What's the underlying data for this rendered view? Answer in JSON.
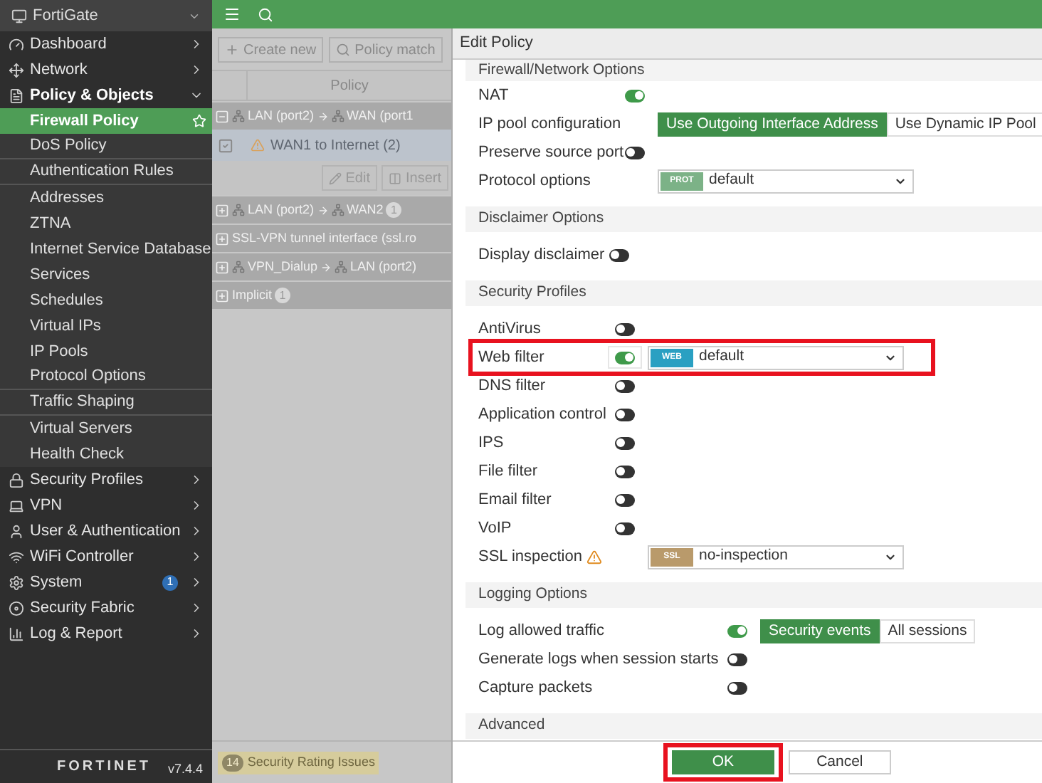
{
  "sidebar": {
    "device": "FortiGate",
    "items": [
      {
        "label": "Dashboard",
        "expanded": false
      },
      {
        "label": "Network",
        "expanded": false
      },
      {
        "label": "Policy & Objects",
        "expanded": true,
        "children": [
          {
            "label": "Firewall Policy",
            "selected": true,
            "group_end": false
          },
          {
            "label": "DoS Policy",
            "selected": false,
            "group_end": true
          },
          {
            "label": "Authentication Rules",
            "selected": false,
            "group_end": true
          },
          {
            "label": "Addresses",
            "selected": false,
            "group_end": false
          },
          {
            "label": "ZTNA",
            "selected": false,
            "group_end": false
          },
          {
            "label": "Internet Service Database",
            "selected": false,
            "group_end": false
          },
          {
            "label": "Services",
            "selected": false,
            "group_end": false
          },
          {
            "label": "Schedules",
            "selected": false,
            "group_end": false
          },
          {
            "label": "Virtual IPs",
            "selected": false,
            "group_end": false
          },
          {
            "label": "IP Pools",
            "selected": false,
            "group_end": false
          },
          {
            "label": "Protocol Options",
            "selected": false,
            "group_end": true
          },
          {
            "label": "Traffic Shaping",
            "selected": false,
            "group_end": true
          },
          {
            "label": "Virtual Servers",
            "selected": false,
            "group_end": false
          },
          {
            "label": "Health Check",
            "selected": false,
            "group_end": false
          }
        ]
      },
      {
        "label": "Security Profiles",
        "expanded": false
      },
      {
        "label": "VPN",
        "expanded": false
      },
      {
        "label": "User & Authentication",
        "expanded": false
      },
      {
        "label": "WiFi Controller",
        "expanded": false
      },
      {
        "label": "System",
        "expanded": false,
        "badge": "1"
      },
      {
        "label": "Security Fabric",
        "expanded": false
      },
      {
        "label": "Log & Report",
        "expanded": false
      }
    ],
    "brand": "FORTINET",
    "version": "v7.4.4"
  },
  "toolbar": [
    "Create new",
    "Policy match"
  ],
  "table": {
    "columns": [
      "Policy"
    ],
    "rows": [
      {
        "kind": "group",
        "expanded": true,
        "from": "LAN (port2)",
        "to": "WAN (port1"
      },
      {
        "kind": "policy",
        "checked": true,
        "name": "WAN1 to Internet (2)"
      },
      {
        "kind": "actions",
        "buttons": [
          "Edit",
          "Insert"
        ]
      },
      {
        "kind": "group",
        "expanded": false,
        "from": "LAN (port2)",
        "to": "WAN2",
        "count": "1"
      },
      {
        "kind": "group",
        "expanded": false,
        "from": "SSL-VPN tunnel interface (ssl.ro"
      },
      {
        "kind": "group",
        "expanded": false,
        "from": "VPN_Dialup",
        "to": "LAN (port2)"
      },
      {
        "kind": "group",
        "expanded": false,
        "from": "Implicit",
        "count": "1"
      }
    ]
  },
  "status_bar": {
    "count": "14",
    "label": "Security Rating Issues"
  },
  "dialog": {
    "title": "Edit Policy",
    "sections": [
      {
        "title": "Firewall/Network Options",
        "rows": [
          {
            "label": "NAT",
            "on": true
          },
          {
            "label": "IP pool configuration",
            "options": [
              {
                "label": "Use Outgoing Interface Address",
                "selected": true
              },
              {
                "label": "Use Dynamic IP Pool",
                "selected": false
              }
            ]
          },
          {
            "label": "Preserve source port",
            "on": false
          },
          {
            "label": "Protocol options",
            "select": {
              "tag": "PROT",
              "color": "#7cb287",
              "value": "default"
            }
          }
        ]
      },
      {
        "title": "Disclaimer Options",
        "rows": [
          {
            "label": "Display disclaimer",
            "on": false
          }
        ]
      },
      {
        "title": "Security Profiles",
        "rows": [
          {
            "label": "AntiVirus",
            "on": false
          },
          {
            "label": "Web filter",
            "on": true,
            "highlighted": true,
            "select": {
              "tag": "WEB",
              "color": "#2aa0c2",
              "value": "default"
            }
          },
          {
            "label": "DNS filter",
            "on": false
          },
          {
            "label": "Application control",
            "on": false
          },
          {
            "label": "IPS",
            "on": false
          },
          {
            "label": "File filter",
            "on": false
          },
          {
            "label": "Email filter",
            "on": false
          },
          {
            "label": "VoIP",
            "on": false
          },
          {
            "label": "SSL inspection",
            "warning": true,
            "select": {
              "tag": "SSL",
              "color": "#b99a6b",
              "value": "no-inspection"
            }
          }
        ]
      },
      {
        "title": "Logging Options",
        "rows": [
          {
            "label": "Log allowed traffic",
            "on": true,
            "options": [
              {
                "label": "Security events",
                "selected": true
              },
              {
                "label": "All sessions",
                "selected": false
              }
            ]
          },
          {
            "label": "Generate logs when session starts",
            "on": false
          },
          {
            "label": "Capture packets",
            "on": false
          }
        ]
      },
      {
        "title": "Advanced"
      }
    ],
    "buttons": [
      {
        "label": "OK",
        "kind": "primary",
        "highlighted": true
      },
      {
        "label": "Cancel",
        "kind": "secondary",
        "highlighted": false
      }
    ]
  }
}
